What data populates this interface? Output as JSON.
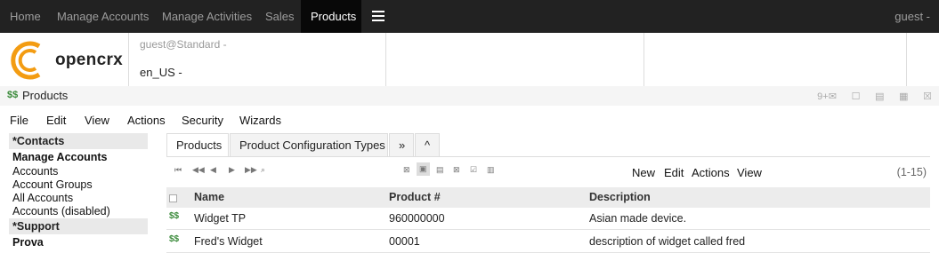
{
  "nav": {
    "items": [
      "Home",
      "Manage Accounts",
      "Manage Activities",
      "Sales",
      "Products"
    ],
    "active": "Products",
    "user": "guest -"
  },
  "header": {
    "logo_text": "opencrx",
    "login": "guest@Standard -",
    "locale": "en_US -"
  },
  "titlebar": {
    "title": "Products",
    "mail_count": "9+"
  },
  "menu": [
    "File",
    "Edit",
    "View",
    "Actions",
    "Security",
    "Wizards"
  ],
  "sidebar": {
    "groups": [
      {
        "header": "*Contacts"
      },
      {
        "label": "Manage Accounts",
        "bold": true
      },
      {
        "label": "Accounts"
      },
      {
        "label": "Account Groups"
      },
      {
        "label": "All Accounts"
      },
      {
        "label": "Accounts (disabled)"
      },
      {
        "header": "*Support"
      },
      {
        "label": "Prova",
        "bold": true
      }
    ]
  },
  "tabs": [
    "Products",
    "Product Configuration Types",
    "»",
    "^"
  ],
  "grid": {
    "actions": [
      "New",
      "Edit",
      "Actions",
      "View"
    ],
    "count": "(1-15)",
    "columns": [
      "Name",
      "Product #",
      "Description"
    ],
    "rows": [
      {
        "name": "Widget TP",
        "number": "960000000",
        "description": "Asian made device."
      },
      {
        "name": "Fred's Widget",
        "number": "00001",
        "description": "description of widget called fred"
      }
    ]
  },
  "colors": {
    "navbar": "#222222",
    "active_nav": "#080808",
    "logo_orange": "#f39c12",
    "header_gray": "#ececec"
  }
}
